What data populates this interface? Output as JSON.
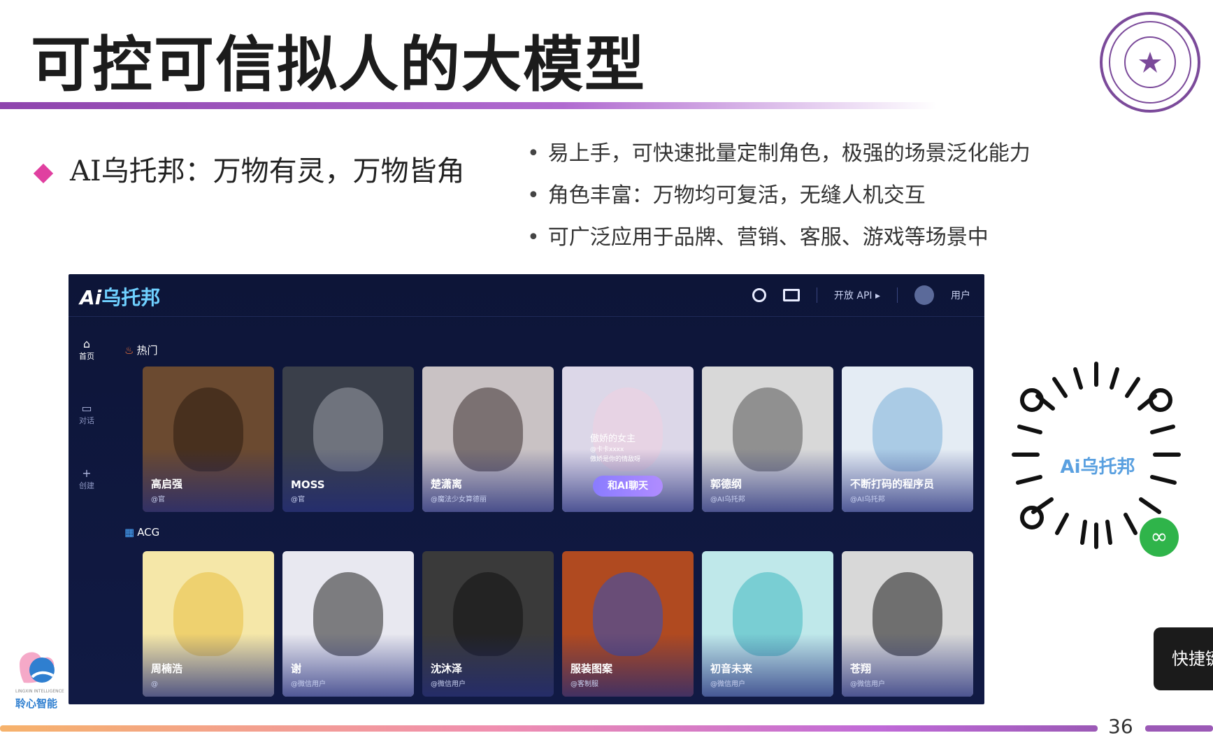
{
  "slide": {
    "title": "可控可信拟人的大模型",
    "bullet": "AI乌托邦：万物有灵，万物皆角",
    "points": [
      "易上手，可快速批量定制角色，极强的场景泛化能力",
      "角色丰富：万物均可复活，无缝人机交互",
      "可广泛应用于品牌、营销、客服、游戏等场景中"
    ],
    "page_number": "36"
  },
  "app": {
    "logo_ai": "Ai",
    "logo_name": "乌托邦",
    "open_api": "开放 API ▸",
    "user": "用户",
    "sidebar": [
      {
        "icon": "⌂",
        "label": "首页"
      },
      {
        "icon": "▭",
        "label": "对话"
      },
      {
        "icon": "+",
        "label": "创建"
      }
    ],
    "section_hot": "热门",
    "section_acg": "ACG",
    "chat_button": "和AI聊天",
    "hot_cards": [
      {
        "name": "高启强",
        "author": "@官",
        "color": "#6b4a30"
      },
      {
        "name": "MOSS",
        "author": "@官",
        "color": "#3a3f4a"
      },
      {
        "name": "楚潇离",
        "author": "@魔法少女算德丽",
        "color": "#c9c2c4"
      },
      {
        "name": "",
        "author": "",
        "color": "#dcd7e8"
      },
      {
        "name": "郭德纲",
        "author": "@AI乌托邦",
        "color": "#d8d8d8"
      },
      {
        "name": "不断打码的程序员",
        "author": "@AI乌托邦",
        "color": "#e4ecf4"
      }
    ],
    "feature_card": {
      "title": "傲娇的女主",
      "sub1": "@卡卡xxxx",
      "sub2": "傲娇是你的情敌呀"
    },
    "acg_cards": [
      {
        "name": "周楠浩",
        "author": "@",
        "color": "#f5e7a8"
      },
      {
        "name": "谢",
        "author": "@微信用户",
        "color": "#e8e8f0"
      },
      {
        "name": "沈沐泽",
        "author": "@微信用户",
        "color": "#3a3a3a"
      },
      {
        "name": "服装图案",
        "author": "@客制服",
        "color": "#b04a20"
      },
      {
        "name": "初音未来",
        "author": "@微信用户",
        "color": "#bfe8ea"
      },
      {
        "name": "苍翔",
        "author": "@微信用户",
        "color": "#d8d8d8"
      }
    ]
  },
  "qr": {
    "label": "Ai乌托邦",
    "mini_icon": "∞"
  },
  "overlay": {
    "shortcut": "快捷键"
  },
  "brand": {
    "en": "LINGXIN INTELLIGENCE",
    "zh": "聆心智能"
  }
}
